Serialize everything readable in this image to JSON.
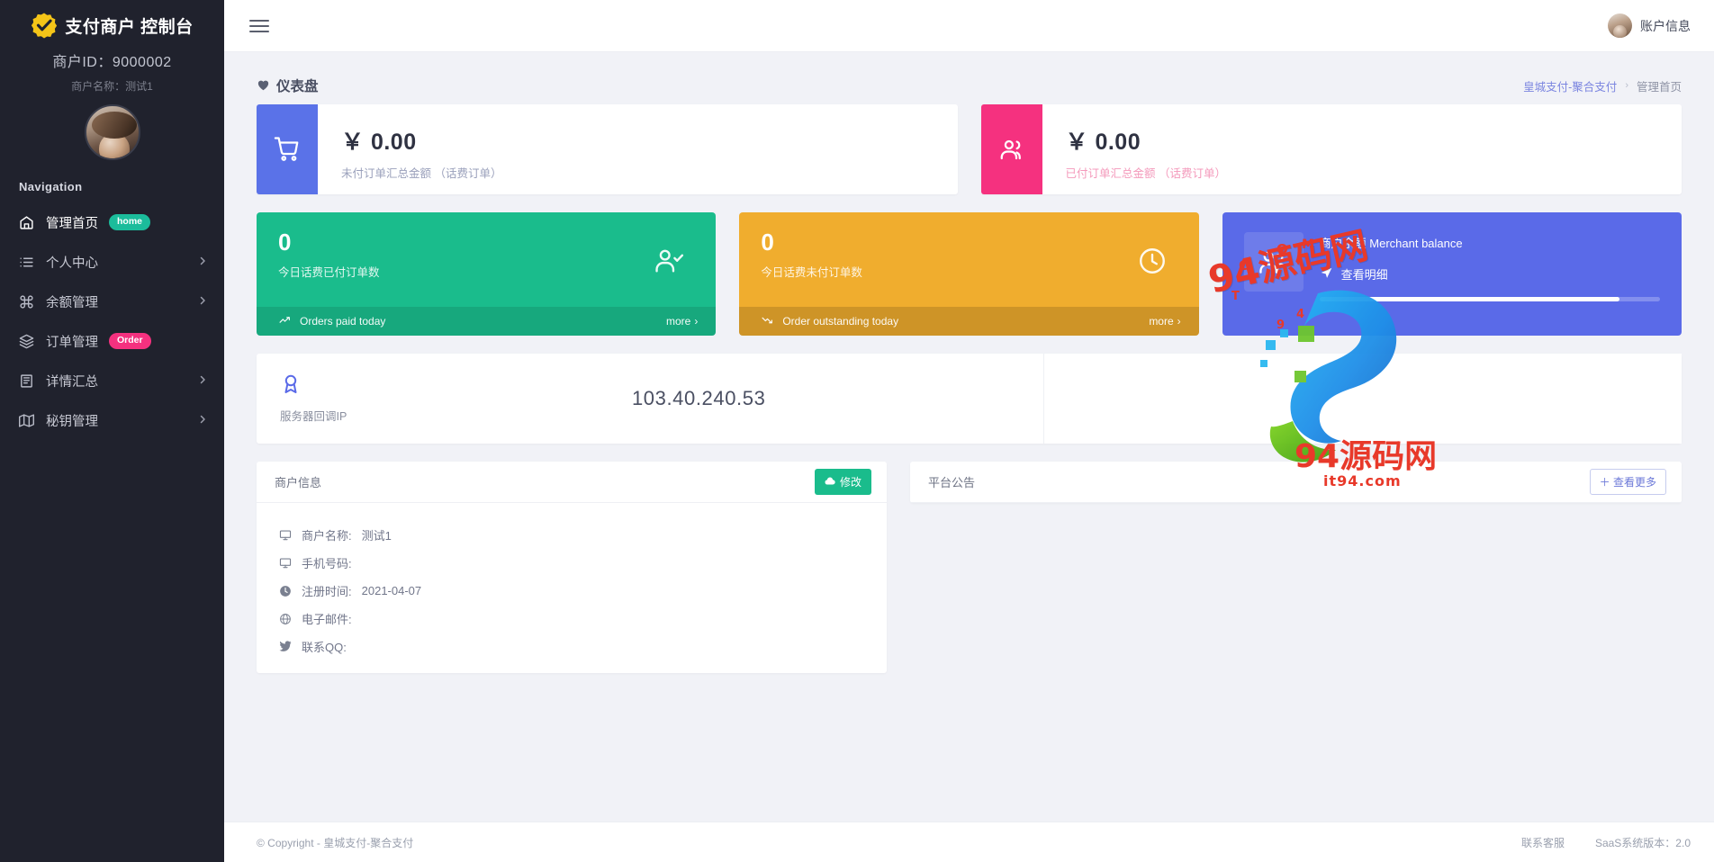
{
  "sidebar": {
    "brand_title": "支付商户 控制台",
    "merchant_id_label": "商户ID：9000002",
    "merchant_name_label": "商户名称：测试1",
    "nav_heading": "Navigation",
    "items": [
      {
        "label": "管理首页",
        "icon": "home-icon",
        "badge": "home",
        "badge_type": "home",
        "chevron": false,
        "active": true
      },
      {
        "label": "个人中心",
        "icon": "list-icon",
        "badge": "",
        "badge_type": "",
        "chevron": true,
        "active": false
      },
      {
        "label": "余额管理",
        "icon": "command-icon",
        "badge": "",
        "badge_type": "",
        "chevron": true,
        "active": false
      },
      {
        "label": "订单管理",
        "icon": "layers-icon",
        "badge": "Order",
        "badge_type": "order",
        "chevron": false,
        "active": false
      },
      {
        "label": "详情汇总",
        "icon": "book-icon",
        "badge": "",
        "badge_type": "",
        "chevron": true,
        "active": false
      },
      {
        "label": "秘钥管理",
        "icon": "map-icon",
        "badge": "",
        "badge_type": "",
        "chevron": true,
        "active": false
      }
    ]
  },
  "topbar": {
    "menu_icon": "hamburger-icon",
    "account_label": "账户信息"
  },
  "page": {
    "title": "仪表盘",
    "title_icon": "heart-icon",
    "breadcrumb_root": "皇城支付-聚合支付",
    "breadcrumb_sep": "›",
    "breadcrumb_current": "管理首页"
  },
  "money_cards": [
    {
      "value": "￥ 0.00",
      "label": "未付订单汇总金额 （话费订单）",
      "icon": "cart-icon",
      "color": "#5a72e8",
      "tone": "blue"
    },
    {
      "value": "￥ 0.00",
      "label": "已付订单汇总金额 （话费订单）",
      "icon": "users-icon",
      "color": "#f5317f",
      "tone": "pink"
    }
  ],
  "tiles": [
    {
      "number": "0",
      "label": "今日话费已付订单数",
      "footer_label": "Orders paid today",
      "more_label": "more",
      "more_chevron": "›",
      "icon": "user-check-icon",
      "trend_icon": "trend-up-icon",
      "color": "#1abc8c"
    },
    {
      "number": "0",
      "label": "今日话费未付订单数",
      "footer_label": "Order outstanding today",
      "more_label": "more",
      "more_chevron": "›",
      "icon": "clock-icon",
      "trend_icon": "trend-down-icon",
      "color": "#f0ad2e"
    }
  ],
  "balance_card": {
    "title": "商户余额 Merchant balance",
    "link_label": "查看明细",
    "link_icon": "send-icon",
    "icon": "people-icon",
    "color": "#5a6ae8"
  },
  "ip_card": {
    "caption": "服务器回调IP",
    "value": "103.40.240.53",
    "icon": "award-icon"
  },
  "merchant_panel": {
    "title": "商户信息",
    "edit_label": "修改",
    "edit_icon": "cloud-icon",
    "rows": [
      {
        "icon": "monitor-icon",
        "label": "商户名称:",
        "value": "测试1"
      },
      {
        "icon": "monitor-icon",
        "label": "手机号码:",
        "value": ""
      },
      {
        "icon": "clock-icon",
        "label": "注册时间:",
        "value": "2021-04-07"
      },
      {
        "icon": "globe-icon",
        "label": "电子邮件:",
        "value": ""
      },
      {
        "icon": "twitter-icon",
        "label": "联系QQ:",
        "value": ""
      }
    ]
  },
  "notice_panel": {
    "title": "平台公告",
    "more_label": "＋ 查看更多"
  },
  "footer": {
    "copyright": "© Copyright - 皇城支付-聚合支付",
    "support": "联系客服",
    "version": "SaaS系统版本：2.0"
  },
  "watermark": {
    "line1": "94源码网",
    "line2": "94源码网",
    "line3": "it94.com"
  }
}
